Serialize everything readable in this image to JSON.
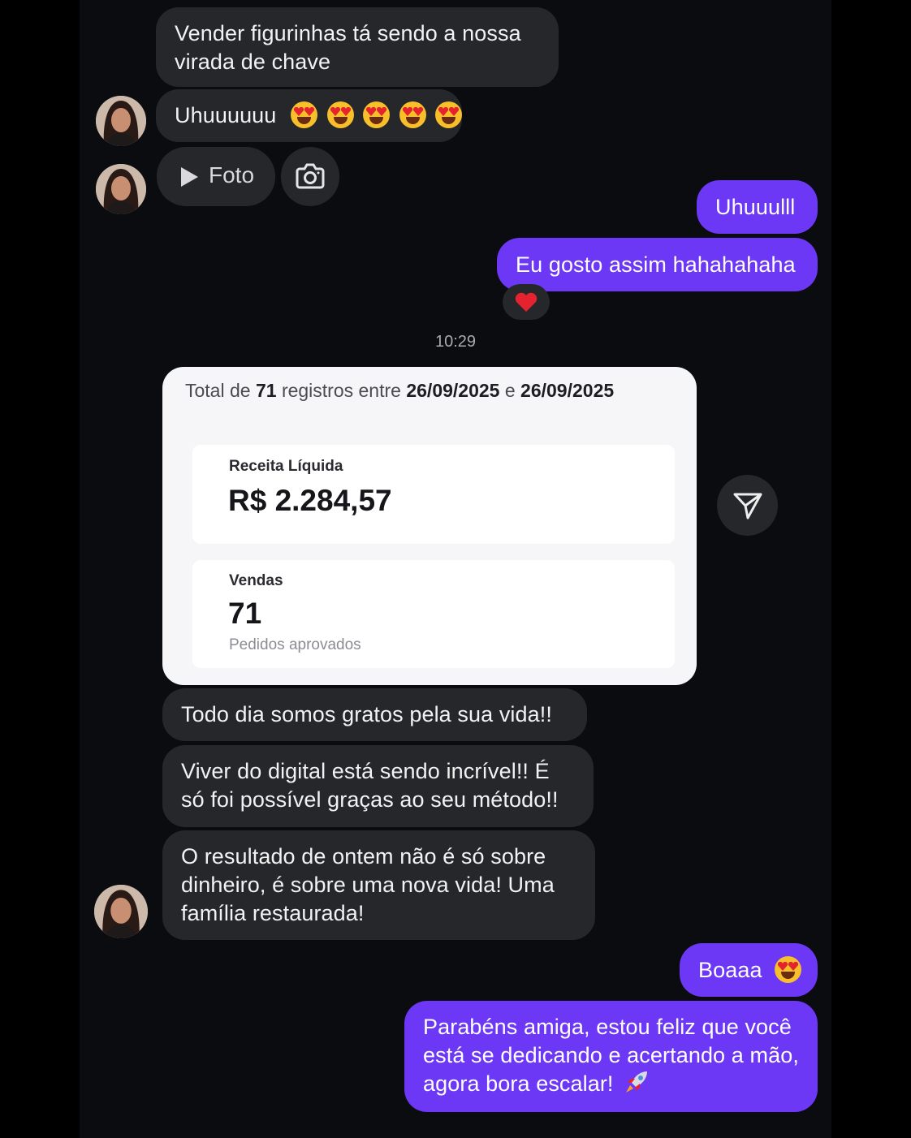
{
  "messages": [
    {
      "text": "Vender figurinhas tá sendo a nossa virada de chave"
    },
    {
      "text": "Uhuuuuuu"
    },
    {
      "media_label": "Foto"
    },
    {
      "text": "Uhuuulll"
    },
    {
      "text": "Eu gosto assim hahahahaha",
      "reaction": "heart"
    },
    {
      "text": "Todo dia somos gratos pela sua vida!!"
    },
    {
      "text": "Viver do digital está sendo incrível!! É só foi possível graças ao seu método!!"
    },
    {
      "text": "O resultado de ontem não é só sobre dinheiro, é sobre uma nova vida! Uma família restaurada!"
    },
    {
      "text": "Boaaa"
    },
    {
      "text": "Parabéns amiga, estou feliz que você está se dedicando e acertando a mão, agora bora escalar!"
    }
  ],
  "timestamp": "10:29",
  "report": {
    "prefix": "Total de",
    "count": "71",
    "middle": "registros entre",
    "date_start": "26/09/2025",
    "conj": "e",
    "date_end": "26/09/2025",
    "revenue_label": "Receita Líquida",
    "revenue_value": "R$ 2.284,57",
    "sales_label": "Vendas",
    "sales_value": "71",
    "sales_sub": "Pedidos aprovados"
  },
  "icons": {
    "play": "play-icon",
    "camera": "camera-icon",
    "send": "send-icon",
    "heart": "heart-icon",
    "emoji": "heart-eyes-emoji",
    "rocket": "rocket-emoji"
  },
  "colors": {
    "outgoing_bubble": "#6c37f5",
    "incoming_bubble": "#26272b",
    "background": "#0b0c10",
    "heart": "#e5232f"
  }
}
